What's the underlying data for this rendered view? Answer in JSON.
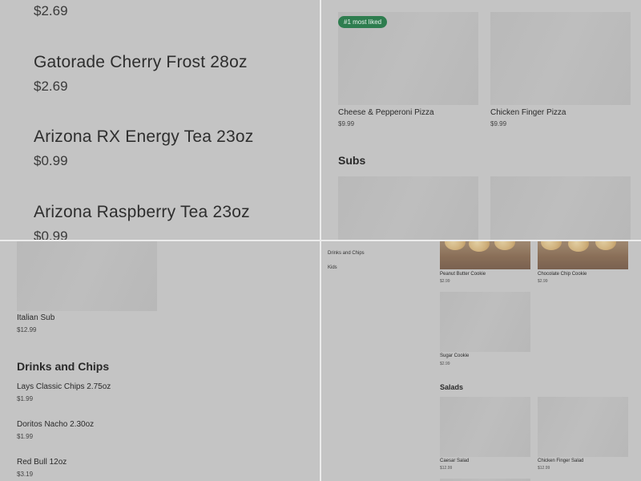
{
  "top_left": {
    "cut_price": "$2.69",
    "items": [
      {
        "name": "Gatorade Cherry Frost 28oz",
        "price": "$2.69"
      },
      {
        "name": "Arizona RX Energy Tea 23oz",
        "price": "$0.99"
      },
      {
        "name": "Arizona Raspberry Tea 23oz",
        "price": "$0.99"
      }
    ]
  },
  "top_right": {
    "badge": "#1 most liked",
    "cards": [
      {
        "name": "Cheese & Pepperoni Pizza",
        "price": "$9.99"
      },
      {
        "name": "Chicken Finger Pizza",
        "price": "$9.99"
      }
    ],
    "section_subs": "Subs"
  },
  "bottom_left": {
    "sub_item": {
      "name": "Italian Sub",
      "price": "$12.99"
    },
    "section": "Drinks and Chips",
    "items": [
      {
        "name": "Lays Classic Chips 2.75oz",
        "price": "$1.99"
      },
      {
        "name": "Doritos Nacho 2.30oz",
        "price": "$1.99"
      },
      {
        "name": "Red Bull 12oz",
        "price": "$3.19"
      }
    ]
  },
  "bottom_right": {
    "nav": [
      "Drinks and Chips",
      "Kids"
    ],
    "cookies": [
      {
        "name": "Peanut Butter Cookie",
        "price": "$2.99"
      },
      {
        "name": "Chocolate Chip Cookie",
        "price": "$2.99"
      },
      {
        "name": "Sugar Cookie",
        "price": "$2.99"
      }
    ],
    "section_salads": "Salads",
    "salads": [
      {
        "name": "Caesar Salad",
        "price": "$12.99"
      },
      {
        "name": "Chicken Finger Salad",
        "price": "$12.99"
      }
    ]
  },
  "colors": {
    "background": "#c4c4c4",
    "placeholder": "#bababa",
    "badge": "#2e7d4f"
  }
}
